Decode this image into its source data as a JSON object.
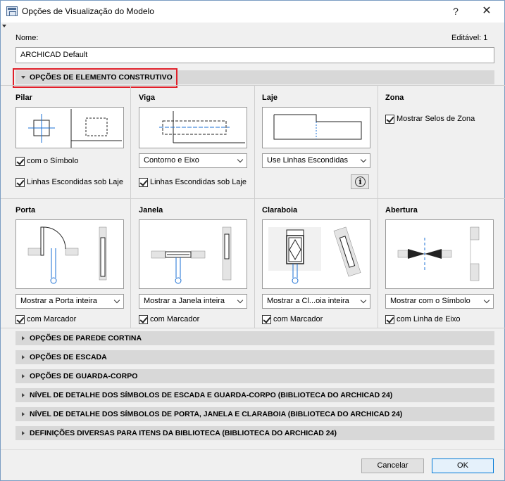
{
  "window": {
    "title": "Opções de Visualização do Modelo",
    "help": "?",
    "close": "✕"
  },
  "name_label": "Nome:",
  "editable_label": "Editável: 1",
  "name_value": "ARCHICAD Default",
  "sections": {
    "construction": "OPÇÕES DE ELEMENTO CONSTRUTIVO",
    "collapsed": [
      "OPÇÕES DE PAREDE CORTINA",
      "OPÇÕES DE ESCADA",
      "OPÇÕES DE GUARDA-CORPO",
      "NÍVEL DE DETALHE DOS SÍMBOLOS DE ESCADA E GUARDA-CORPO (BIBLIOTECA DO ARCHICAD 24)",
      "NÍVEL DE DETALHE DOS SÍMBOLOS DE PORTA, JANELA E CLARABOIA (BIBLIOTECA DO ARCHICAD 24)",
      "DEFINIÇÕES DIVERSAS PARA ITENS DA BIBLIOTECA (BIBLIOTECA DO ARCHICAD 24)"
    ]
  },
  "pilar": {
    "title": "Pilar",
    "chk1": "com o Símbolo",
    "chk2": "Linhas Escondidas sob Laje"
  },
  "viga": {
    "title": "Viga",
    "select": "Contorno e Eixo",
    "chk": "Linhas Escondidas sob Laje"
  },
  "laje": {
    "title": "Laje",
    "select": "Use Linhas Escondidas",
    "info": "i"
  },
  "zona": {
    "title": "Zona",
    "chk": "Mostrar Selos de Zona"
  },
  "porta": {
    "title": "Porta",
    "select": "Mostrar a Porta inteira",
    "chk": "com Marcador"
  },
  "janela": {
    "title": "Janela",
    "select": "Mostrar a Janela inteira",
    "chk": "com Marcador"
  },
  "claraboia": {
    "title": "Claraboia",
    "select": "Mostrar a Cl...oia inteira",
    "chk": "com Marcador"
  },
  "abertura": {
    "title": "Abertura",
    "select": "Mostrar com o Símbolo",
    "chk": "com Linha de Eixo"
  },
  "buttons": {
    "cancel": "Cancelar",
    "ok": "OK"
  },
  "colors": {
    "highlight": "#e0202a",
    "section_bg": "#d8d8d8",
    "accent": "#0078d7",
    "symbol_blue": "#1a6fd4"
  }
}
